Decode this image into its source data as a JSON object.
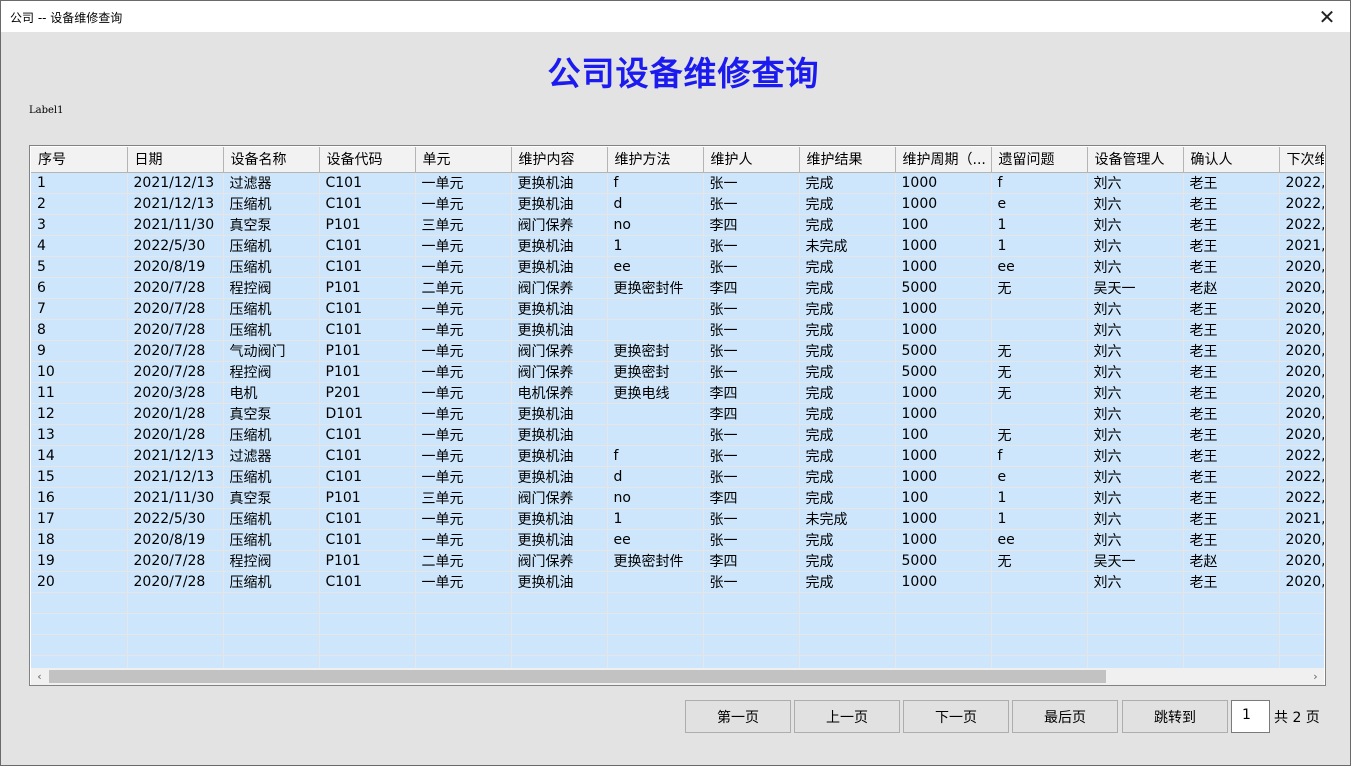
{
  "window": {
    "title": "公司 -- 设备维修查询",
    "close_glyph": "✕"
  },
  "heading": "公司设备维修查询",
  "label1": "Label1",
  "table": {
    "columns": [
      "序号",
      "日期",
      "设备名称",
      "设备代码",
      "单元",
      "维护内容",
      "维护方法",
      "维护人",
      "维护结果",
      "维护周期（...",
      "遗留问题",
      "设备管理人",
      "确认人",
      "下次维"
    ],
    "rows": [
      [
        "1",
        "2021/12/13",
        "过滤器",
        "C101",
        "一单元",
        "更换机油",
        "f",
        "张一",
        "完成",
        "1000",
        "f",
        "刘六",
        "老王",
        "2022,"
      ],
      [
        "2",
        "2021/12/13",
        "压缩机",
        "C101",
        "一单元",
        "更换机油",
        "d",
        "张一",
        "完成",
        "1000",
        "e",
        "刘六",
        "老王",
        "2022,"
      ],
      [
        "3",
        "2021/11/30",
        "真空泵",
        "P101",
        "三单元",
        "阀门保养",
        "no",
        "李四",
        "完成",
        "100",
        "1",
        "刘六",
        "老王",
        "2022,"
      ],
      [
        "4",
        "2022/5/30",
        "压缩机",
        "C101",
        "一单元",
        "更换机油",
        "1",
        "张一",
        "未完成",
        "1000",
        "1",
        "刘六",
        "老王",
        "2021,"
      ],
      [
        "5",
        "2020/8/19",
        "压缩机",
        "C101",
        "一单元",
        "更换机油",
        "ee",
        "张一",
        "完成",
        "1000",
        "ee",
        "刘六",
        "老王",
        "2020,"
      ],
      [
        "6",
        "2020/7/28",
        "程控阀",
        "P101",
        "二单元",
        "阀门保养",
        "更换密封件",
        "李四",
        "完成",
        "5000",
        "无",
        "吴天一",
        "老赵",
        "2020,"
      ],
      [
        "7",
        "2020/7/28",
        "压缩机",
        "C101",
        "一单元",
        "更换机油",
        "",
        "张一",
        "完成",
        "1000",
        "",
        "刘六",
        "老王",
        "2020,"
      ],
      [
        "8",
        "2020/7/28",
        "压缩机",
        "C101",
        "一单元",
        "更换机油",
        "",
        "张一",
        "完成",
        "1000",
        "",
        "刘六",
        "老王",
        "2020,"
      ],
      [
        "9",
        "2020/7/28",
        "气动阀门",
        "P101",
        "一单元",
        "阀门保养",
        "更换密封",
        "张一",
        "完成",
        "5000",
        "无",
        "刘六",
        "老王",
        "2020,"
      ],
      [
        "10",
        "2020/7/28",
        "程控阀",
        "P101",
        "一单元",
        "阀门保养",
        "更换密封",
        "张一",
        "完成",
        "5000",
        "无",
        "刘六",
        "老王",
        "2020,"
      ],
      [
        "11",
        "2020/3/28",
        "电机",
        "P201",
        "一单元",
        "电机保养",
        "更换电线",
        "李四",
        "完成",
        "1000",
        "无",
        "刘六",
        "老王",
        "2020,"
      ],
      [
        "12",
        "2020/1/28",
        "真空泵",
        "D101",
        "一单元",
        "更换机油",
        "",
        "李四",
        "完成",
        "1000",
        "",
        "刘六",
        "老王",
        "2020,"
      ],
      [
        "13",
        "2020/1/28",
        "压缩机",
        "C101",
        "一单元",
        "更换机油",
        "",
        "张一",
        "完成",
        "100",
        "无",
        "刘六",
        "老王",
        "2020,"
      ],
      [
        "14",
        "2021/12/13",
        "过滤器",
        "C101",
        "一单元",
        "更换机油",
        "f",
        "张一",
        "完成",
        "1000",
        "f",
        "刘六",
        "老王",
        "2022,"
      ],
      [
        "15",
        "2021/12/13",
        "压缩机",
        "C101",
        "一单元",
        "更换机油",
        "d",
        "张一",
        "完成",
        "1000",
        "e",
        "刘六",
        "老王",
        "2022,"
      ],
      [
        "16",
        "2021/11/30",
        "真空泵",
        "P101",
        "三单元",
        "阀门保养",
        "no",
        "李四",
        "完成",
        "100",
        "1",
        "刘六",
        "老王",
        "2022,"
      ],
      [
        "17",
        "2022/5/30",
        "压缩机",
        "C101",
        "一单元",
        "更换机油",
        "1",
        "张一",
        "未完成",
        "1000",
        "1",
        "刘六",
        "老王",
        "2021,"
      ],
      [
        "18",
        "2020/8/19",
        "压缩机",
        "C101",
        "一单元",
        "更换机油",
        "ee",
        "张一",
        "完成",
        "1000",
        "ee",
        "刘六",
        "老王",
        "2020,"
      ],
      [
        "19",
        "2020/7/28",
        "程控阀",
        "P101",
        "二单元",
        "阀门保养",
        "更换密封件",
        "李四",
        "完成",
        "5000",
        "无",
        "吴天一",
        "老赵",
        "2020,"
      ],
      [
        "20",
        "2020/7/28",
        "压缩机",
        "C101",
        "一单元",
        "更换机油",
        "",
        "张一",
        "完成",
        "1000",
        "",
        "刘六",
        "老王",
        "2020,"
      ]
    ]
  },
  "scrollbar": {
    "left_glyph": "‹",
    "right_glyph": "›"
  },
  "pager": {
    "first": "第一页",
    "prev": "上一页",
    "next": "下一页",
    "last": "最后页",
    "jump": "跳转到",
    "page_value": "1",
    "total": "共 2 页"
  }
}
